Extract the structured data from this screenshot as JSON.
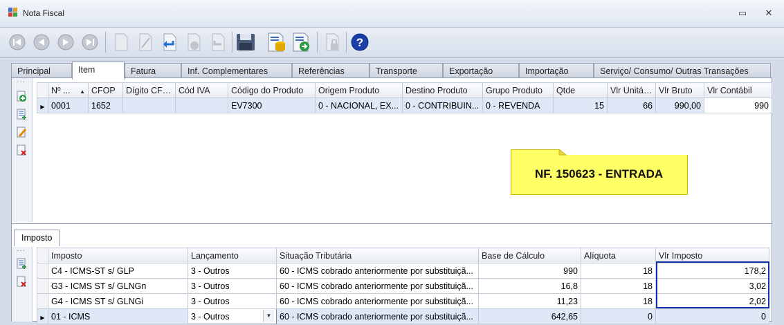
{
  "window": {
    "title": "Nota Fiscal",
    "minimize": "▭",
    "close": "✕"
  },
  "toolbar": {
    "buttons": [
      "first-record-icon",
      "previous-record-icon",
      "next-record-icon",
      "last-record-icon",
      "new-document-icon",
      "edit-icon",
      "undo-icon",
      "delete-icon",
      "redo-icon",
      "save-icon",
      "database-report-icon",
      "export-icon",
      "lock-icon",
      "help-icon"
    ]
  },
  "tabs": [
    {
      "label": "Principal"
    },
    {
      "label": "Item"
    },
    {
      "label": "Fatura"
    },
    {
      "label": "Inf. Complementares"
    },
    {
      "label": "Referências"
    },
    {
      "label": "Transporte"
    },
    {
      "label": "Exportação"
    },
    {
      "label": "Importação"
    },
    {
      "label": "Serviço/ Consumo/ Outras Transações"
    }
  ],
  "items_grid": {
    "columns": [
      "Nº ...",
      "CFOP",
      "Dígito CFOP",
      "Cód IVA",
      "Código do Produto",
      "Origem Produto",
      "Destino Produto",
      "Grupo Produto",
      "Qtde",
      "Vlr Unitário",
      "Vlr Bruto",
      "Vlr Contábil"
    ],
    "sort_indicator": "▲",
    "rows": [
      [
        "0001",
        "1652",
        "",
        "",
        "EV7300",
        "0 - NACIONAL, EX...",
        "0 - CONTRIBUIN...",
        "0 - REVENDA",
        "15",
        "66",
        "990,00",
        "990"
      ]
    ]
  },
  "note": {
    "text": "NF. 150623 - ENTRADA"
  },
  "tax_section": {
    "tab_label": "Imposto",
    "columns": [
      "Imposto",
      "Lançamento",
      "Situação Tributária",
      "Base de Cálculo",
      "Alíquota",
      "Vlr Imposto"
    ],
    "rows": [
      [
        "C4 - ICMS-ST s/ GLP",
        "3 - Outros",
        "60 - ICMS cobrado anteriormente por substituiçã...",
        "990",
        "18",
        "178,2"
      ],
      [
        "G3 - ICMS ST s/ GLNGn",
        "3 - Outros",
        "60 - ICMS cobrado anteriormente por substituiçã...",
        "16,8",
        "18",
        "3,02"
      ],
      [
        "G4 - ICMS ST s/ GLNGi",
        "3 - Outros",
        "60 - ICMS cobrado anteriormente por substituiçã...",
        "11,23",
        "18",
        "2,02"
      ],
      [
        "01 - ICMS",
        "3 - Outros",
        "60 - ICMS cobrado anteriormente por substituiçã...",
        "642,65",
        "0",
        "0"
      ]
    ]
  },
  "colors": {
    "highlight_border": "#1530a8",
    "note_background": "#ffff66",
    "selected_row": "#dfe8f6"
  }
}
